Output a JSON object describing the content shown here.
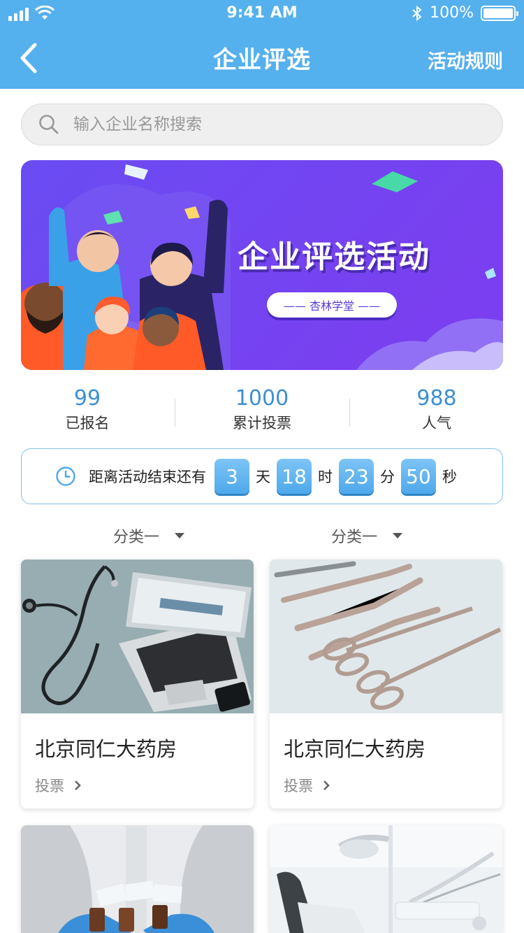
{
  "status_bar": {
    "time": "9:41 AM",
    "battery": "100%"
  },
  "nav": {
    "title": "企业评选",
    "rules": "活动规则"
  },
  "search": {
    "placeholder": "输入企业名称搜索"
  },
  "banner": {
    "title": "企业评选活动",
    "subtitle": "—— 杏林学堂 ——"
  },
  "stats": [
    {
      "value": "99",
      "label": "已报名"
    },
    {
      "value": "1000",
      "label": "累计投票"
    },
    {
      "value": "988",
      "label": "人气"
    }
  ],
  "countdown": {
    "label": "距离活动结束还有",
    "days": "3",
    "day_unit": "天",
    "hours": "18",
    "hour_unit": "时",
    "minutes": "23",
    "minute_unit": "分",
    "seconds": "50",
    "second_unit": "秒"
  },
  "filters": [
    {
      "label": "分类一"
    },
    {
      "label": "分类一"
    }
  ],
  "cards": [
    {
      "name": "北京同仁大药房",
      "vote": "投票"
    },
    {
      "name": "北京同仁大药房",
      "vote": "投票"
    }
  ],
  "colors": {
    "header": "#55b0ee",
    "accent": "#3c8fd4",
    "banner": "#6a3df0"
  }
}
